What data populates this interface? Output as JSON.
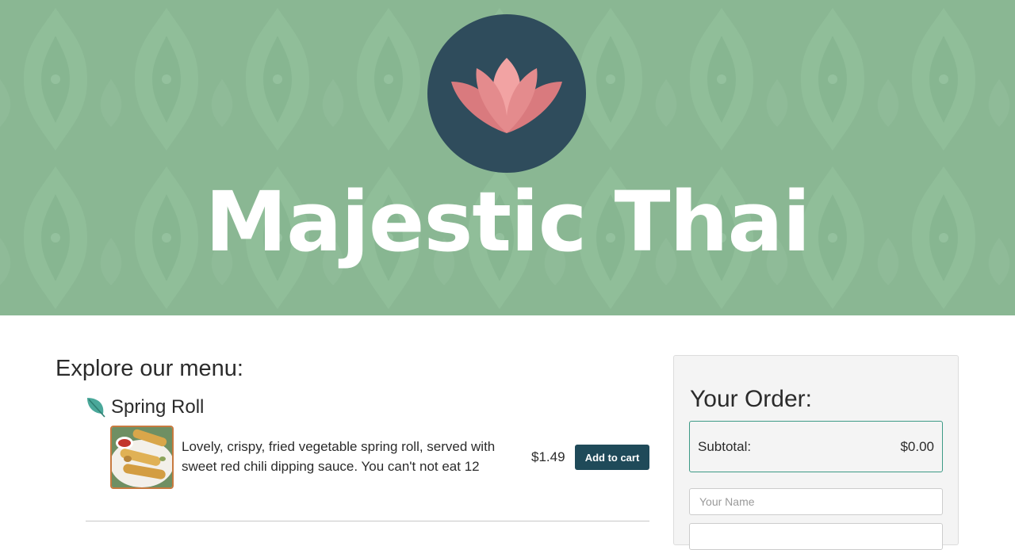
{
  "header": {
    "title": "Majestic Thai",
    "logo_icon": "lotus-icon",
    "background_color": "#8ab793",
    "logo_circle_color": "#2f4c5c",
    "lotus_colors": [
      "#f2a3a3",
      "#e48b8d",
      "#d97a7e"
    ]
  },
  "menu": {
    "heading": "Explore our menu:",
    "items": [
      {
        "icon": "leaf-icon",
        "name": "Spring Roll",
        "description": "Lovely, crispy, fried vegetable spring roll, served with sweet red chili dipping sauce. You can't not eat 12",
        "price": "$1.49",
        "add_label": "Add to cart"
      }
    ]
  },
  "order": {
    "title": "Your Order:",
    "subtotal_label": "Subtotal:",
    "subtotal_value": "$0.00",
    "name_placeholder": "Your Name",
    "next_placeholder": ""
  },
  "colors": {
    "accent": "#1f4a59",
    "leaf": "#4aa89a",
    "subtotal_border": "#3d9a86",
    "thumb_border": "#c87a3f"
  }
}
